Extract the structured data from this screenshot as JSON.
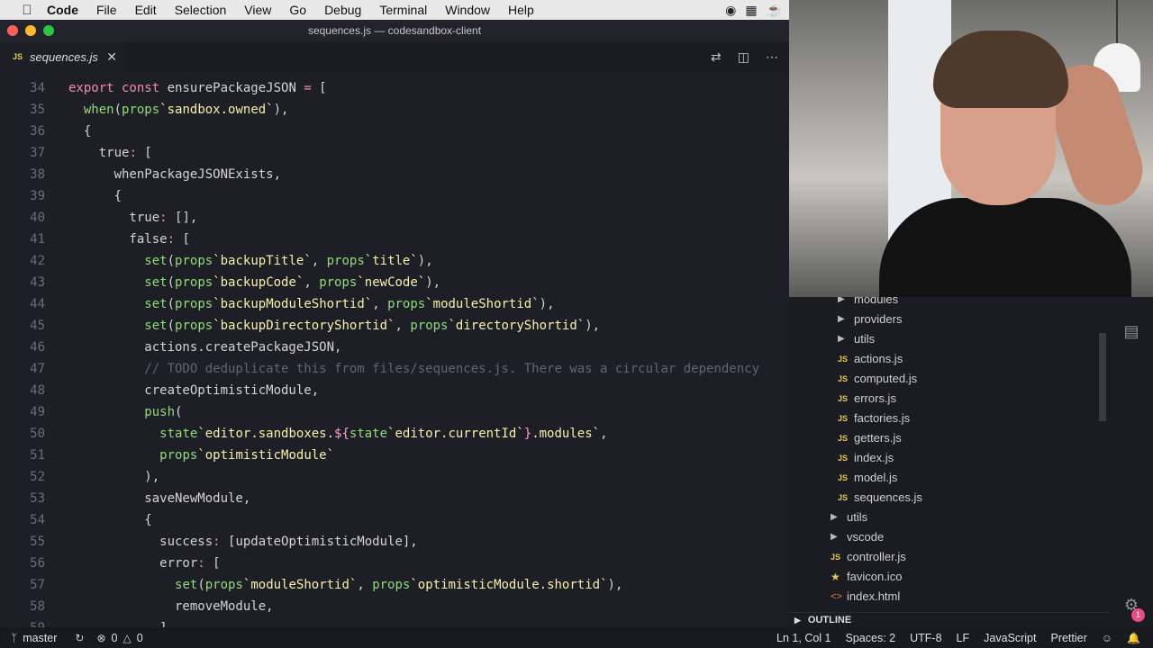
{
  "menubar": {
    "app": "Code",
    "items": [
      "File",
      "Edit",
      "Selection",
      "View",
      "Go",
      "Debug",
      "Terminal",
      "Window",
      "Help"
    ]
  },
  "window": {
    "title": "sequences.js — codesandbox-client"
  },
  "tab": {
    "badge": "JS",
    "label": "sequences.js"
  },
  "editor": {
    "lines": [
      {
        "n": "34",
        "segments": [
          [
            "kw",
            "export const "
          ],
          [
            "pl",
            "ensurePackageJSON "
          ],
          [
            "kw",
            "= "
          ],
          [
            "pl",
            "["
          ]
        ]
      },
      {
        "n": "35",
        "segments": [
          [
            "pl",
            "  "
          ],
          [
            "fn",
            "when"
          ],
          [
            "pl",
            "("
          ],
          [
            "pr",
            "props"
          ],
          [
            "st",
            "`sandbox.owned`"
          ],
          [
            "pl",
            "),"
          ]
        ]
      },
      {
        "n": "36",
        "segments": [
          [
            "pl",
            "  {"
          ]
        ]
      },
      {
        "n": "37",
        "segments": [
          [
            "pl",
            "    true"
          ],
          [
            "kw",
            ": "
          ],
          [
            "pl",
            "["
          ]
        ]
      },
      {
        "n": "38",
        "segments": [
          [
            "pl",
            "      whenPackageJSONExists,"
          ]
        ]
      },
      {
        "n": "39",
        "segments": [
          [
            "pl",
            "      {"
          ]
        ]
      },
      {
        "n": "40",
        "segments": [
          [
            "pl",
            "        true"
          ],
          [
            "kw",
            ": "
          ],
          [
            "pl",
            "[],"
          ]
        ]
      },
      {
        "n": "41",
        "segments": [
          [
            "pl",
            "        false"
          ],
          [
            "kw",
            ": "
          ],
          [
            "pl",
            "["
          ]
        ]
      },
      {
        "n": "42",
        "segments": [
          [
            "pl",
            "          "
          ],
          [
            "fn",
            "set"
          ],
          [
            "pl",
            "("
          ],
          [
            "pr",
            "props"
          ],
          [
            "st",
            "`backupTitle`"
          ],
          [
            "pl",
            ", "
          ],
          [
            "pr",
            "props"
          ],
          [
            "st",
            "`title`"
          ],
          [
            "pl",
            "),"
          ]
        ]
      },
      {
        "n": "43",
        "segments": [
          [
            "pl",
            "          "
          ],
          [
            "fn",
            "set"
          ],
          [
            "pl",
            "("
          ],
          [
            "pr",
            "props"
          ],
          [
            "st",
            "`backupCode`"
          ],
          [
            "pl",
            ", "
          ],
          [
            "pr",
            "props"
          ],
          [
            "st",
            "`newCode`"
          ],
          [
            "pl",
            "),"
          ]
        ]
      },
      {
        "n": "44",
        "segments": [
          [
            "pl",
            "          "
          ],
          [
            "fn",
            "set"
          ],
          [
            "pl",
            "("
          ],
          [
            "pr",
            "props"
          ],
          [
            "st",
            "`backupModuleShortid`"
          ],
          [
            "pl",
            ", "
          ],
          [
            "pr",
            "props"
          ],
          [
            "st",
            "`moduleShortid`"
          ],
          [
            "pl",
            "),"
          ]
        ]
      },
      {
        "n": "45",
        "segments": [
          [
            "pl",
            "          "
          ],
          [
            "fn",
            "set"
          ],
          [
            "pl",
            "("
          ],
          [
            "pr",
            "props"
          ],
          [
            "st",
            "`backupDirectoryShortid`"
          ],
          [
            "pl",
            ", "
          ],
          [
            "pr",
            "props"
          ],
          [
            "st",
            "`directoryShortid`"
          ],
          [
            "pl",
            "),"
          ]
        ]
      },
      {
        "n": "46",
        "segments": [
          [
            "pl",
            "          actions.createPackageJSON,"
          ]
        ]
      },
      {
        "n": "47",
        "segments": [
          [
            "cm",
            "          // TODO deduplicate this from files/sequences.js. There was a circular dependency"
          ]
        ]
      },
      {
        "n": "48",
        "segments": [
          [
            "pl",
            "          createOptimisticModule,"
          ]
        ]
      },
      {
        "n": "49",
        "segments": [
          [
            "pl",
            "          "
          ],
          [
            "fn",
            "push"
          ],
          [
            "pl",
            "("
          ]
        ]
      },
      {
        "n": "50",
        "segments": [
          [
            "pl",
            "            "
          ],
          [
            "pr",
            "state"
          ],
          [
            "st",
            "`editor.sandboxes."
          ],
          [
            "tp",
            "${"
          ],
          [
            "pr",
            "state"
          ],
          [
            "st",
            "`editor.currentId`"
          ],
          [
            "tp",
            "}"
          ],
          [
            "st",
            ".modules`"
          ],
          [
            "pl",
            ","
          ]
        ]
      },
      {
        "n": "51",
        "segments": [
          [
            "pl",
            "            "
          ],
          [
            "pr",
            "props"
          ],
          [
            "st",
            "`optimisticModule`"
          ]
        ]
      },
      {
        "n": "52",
        "segments": [
          [
            "pl",
            "          ),"
          ]
        ]
      },
      {
        "n": "53",
        "segments": [
          [
            "pl",
            "          saveNewModule,"
          ]
        ]
      },
      {
        "n": "54",
        "segments": [
          [
            "pl",
            "          {"
          ]
        ]
      },
      {
        "n": "55",
        "segments": [
          [
            "pl",
            "            success"
          ],
          [
            "kw",
            ": "
          ],
          [
            "pl",
            "[updateOptimisticModule],"
          ]
        ]
      },
      {
        "n": "56",
        "segments": [
          [
            "pl",
            "            error"
          ],
          [
            "kw",
            ": "
          ],
          [
            "pl",
            "["
          ]
        ]
      },
      {
        "n": "57",
        "segments": [
          [
            "pl",
            "              "
          ],
          [
            "fn",
            "set"
          ],
          [
            "pl",
            "("
          ],
          [
            "pr",
            "props"
          ],
          [
            "st",
            "`moduleShortid`"
          ],
          [
            "pl",
            ", "
          ],
          [
            "pr",
            "props"
          ],
          [
            "st",
            "`optimisticModule.shortid`"
          ],
          [
            "pl",
            "),"
          ]
        ]
      },
      {
        "n": "58",
        "segments": [
          [
            "pl",
            "              removeModule,"
          ]
        ]
      },
      {
        "n": "59",
        "segments": [
          [
            "pl",
            "            ],"
          ]
        ]
      }
    ]
  },
  "explorer": {
    "items": [
      {
        "type": "folder",
        "label": "modules",
        "indent": 2
      },
      {
        "type": "folder",
        "label": "providers",
        "indent": 2
      },
      {
        "type": "folder",
        "label": "utils",
        "indent": 2
      },
      {
        "type": "js",
        "label": "actions.js",
        "indent": 2
      },
      {
        "type": "js",
        "label": "computed.js",
        "indent": 2
      },
      {
        "type": "js",
        "label": "errors.js",
        "indent": 2
      },
      {
        "type": "js",
        "label": "factories.js",
        "indent": 2
      },
      {
        "type": "js",
        "label": "getters.js",
        "indent": 2
      },
      {
        "type": "js",
        "label": "index.js",
        "indent": 2
      },
      {
        "type": "js",
        "label": "model.js",
        "indent": 2
      },
      {
        "type": "js",
        "label": "sequences.js",
        "indent": 2
      },
      {
        "type": "folder",
        "label": "utils",
        "indent": 1
      },
      {
        "type": "folder",
        "label": "vscode",
        "indent": 1
      },
      {
        "type": "js",
        "label": "controller.js",
        "indent": 1
      },
      {
        "type": "star",
        "label": "favicon.ico",
        "indent": 1
      },
      {
        "type": "html",
        "label": "index.html",
        "indent": 1
      }
    ],
    "outline_label": "OUTLINE",
    "notification_count": "1"
  },
  "statusbar": {
    "branch": "master",
    "errors": "0",
    "warnings": "0",
    "position": "Ln 1, Col 1",
    "spaces": "Spaces: 2",
    "encoding": "UTF-8",
    "eol": "LF",
    "language": "JavaScript",
    "formatter": "Prettier"
  }
}
